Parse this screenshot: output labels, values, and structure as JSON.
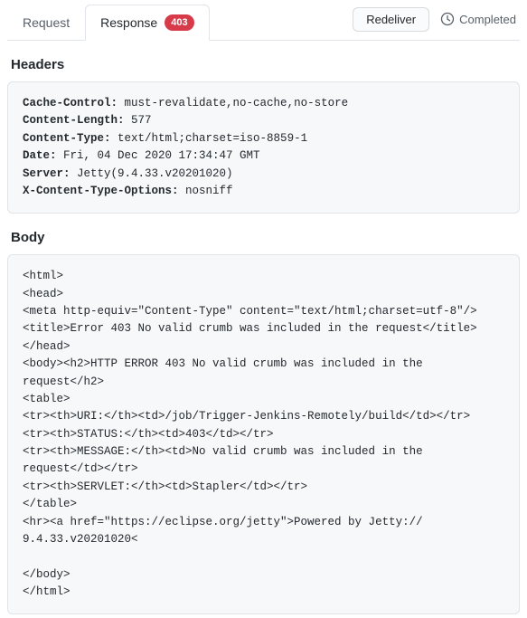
{
  "tabs": {
    "request": "Request",
    "response": "Response",
    "badge": "403"
  },
  "actions": {
    "redeliver": "Redeliver",
    "status": "Completed"
  },
  "sections": {
    "headers_title": "Headers",
    "body_title": "Body"
  },
  "headers": [
    {
      "name": "Cache-Control:",
      "value": " must-revalidate,no-cache,no-store"
    },
    {
      "name": "Content-Length:",
      "value": " 577"
    },
    {
      "name": "Content-Type:",
      "value": " text/html;charset=iso-8859-1"
    },
    {
      "name": "Date:",
      "value": " Fri, 04 Dec 2020 17:34:47 GMT"
    },
    {
      "name": "Server:",
      "value": " Jetty(9.4.33.v20201020)"
    },
    {
      "name": "X-Content-Type-Options:",
      "value": " nosniff"
    }
  ],
  "body_lines": [
    "<html>",
    "<head>",
    "<meta http-equiv=\"Content-Type\" content=\"text/html;charset=utf-8\"/>",
    "<title>Error 403 No valid crumb was included in the request</title>",
    "</head>",
    "<body><h2>HTTP ERROR 403 No valid crumb was included in the request</h2>",
    "<table>",
    "<tr><th>URI:</th><td>/job/Trigger-Jenkins-Remotely/build</td></tr>",
    "<tr><th>STATUS:</th><td>403</td></tr>",
    "<tr><th>MESSAGE:</th><td>No valid crumb was included in the request</td></tr>",
    "<tr><th>SERVLET:</th><td>Stapler</td></tr>",
    "</table>",
    "<hr><a href=\"https://eclipse.org/jetty\">Powered by Jetty:// 9.4.33.v20201020<",
    "",
    "</body>",
    "</html>"
  ]
}
